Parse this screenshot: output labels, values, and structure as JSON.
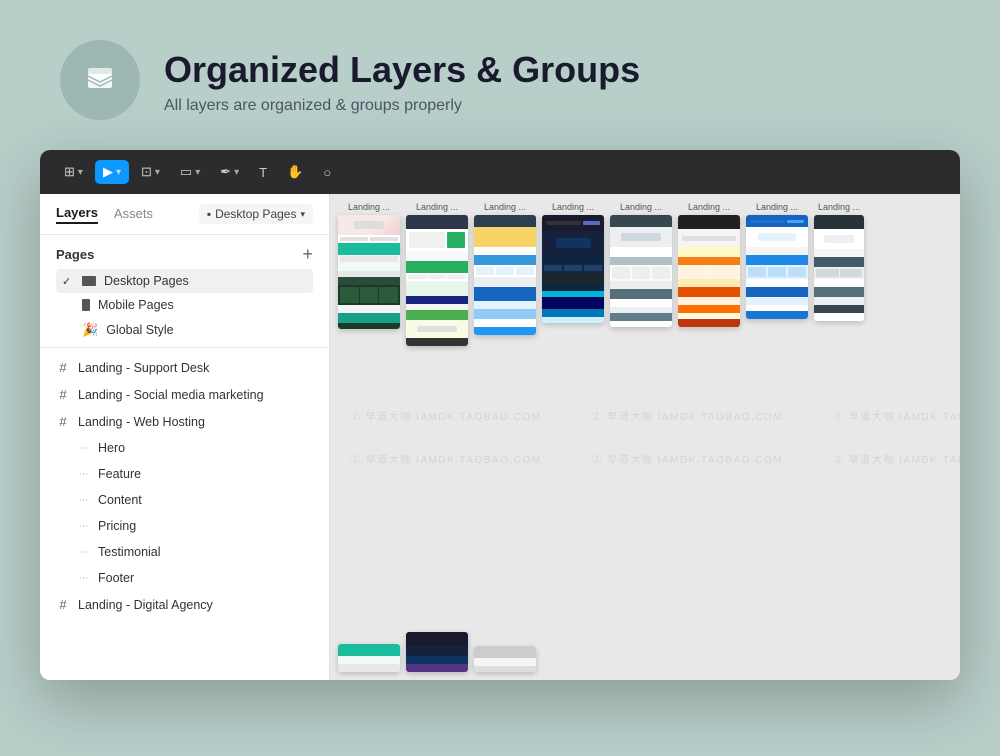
{
  "header": {
    "title": "Organized Layers & Groups",
    "subtitle": "All layers are organized & groups properly",
    "logo_alt": "layers-logo"
  },
  "toolbar": {
    "tools": [
      {
        "id": "frame-tool",
        "label": "⊞",
        "active": false
      },
      {
        "id": "move-tool",
        "label": "▶",
        "active": true
      },
      {
        "id": "scale-tool",
        "label": "⊡",
        "active": false
      },
      {
        "id": "shape-tool",
        "label": "▭",
        "active": false
      },
      {
        "id": "pen-tool",
        "label": "✒",
        "active": false
      },
      {
        "id": "text-tool",
        "label": "T",
        "active": false
      },
      {
        "id": "hand-tool",
        "label": "✋",
        "active": false
      },
      {
        "id": "comment-tool",
        "label": "💬",
        "active": false
      }
    ]
  },
  "left_panel": {
    "tabs": [
      {
        "id": "layers-tab",
        "label": "Layers",
        "active": true
      },
      {
        "id": "assets-tab",
        "label": "Assets",
        "active": false
      }
    ],
    "page_selector": {
      "label": "Desktop Pages",
      "icon": "monitor"
    },
    "pages_section": {
      "title": "Pages",
      "add_label": "+",
      "items": [
        {
          "id": "desktop-pages",
          "label": "Desktop Pages",
          "active": true,
          "checked": true,
          "type": "desktop"
        },
        {
          "id": "mobile-pages",
          "label": "Mobile Pages",
          "active": false,
          "checked": false,
          "type": "mobile"
        },
        {
          "id": "global-style",
          "label": "Global Style",
          "active": false,
          "checked": false,
          "type": "emoji",
          "emoji": "🎉"
        }
      ]
    },
    "layers": [
      {
        "id": "support-desk",
        "label": "Landing - Support Desk",
        "indent": 0,
        "icon": "hash"
      },
      {
        "id": "social-media",
        "label": "Landing - Social media marketing",
        "indent": 0,
        "icon": "hash"
      },
      {
        "id": "web-hosting",
        "label": "Landing - Web Hosting",
        "indent": 0,
        "icon": "hash"
      },
      {
        "id": "hero",
        "label": "Hero",
        "indent": 1,
        "icon": "dots"
      },
      {
        "id": "feature",
        "label": "Feature",
        "indent": 1,
        "icon": "dots"
      },
      {
        "id": "content",
        "label": "Content",
        "indent": 1,
        "icon": "dots"
      },
      {
        "id": "pricing",
        "label": "Pricing",
        "indent": 1,
        "icon": "dots"
      },
      {
        "id": "testimonial",
        "label": "Testimonial",
        "indent": 1,
        "icon": "dots"
      },
      {
        "id": "footer",
        "label": "Footer",
        "indent": 1,
        "icon": "dots"
      },
      {
        "id": "digital-agency",
        "label": "Landing - Digital Agency",
        "indent": 0,
        "icon": "hash"
      }
    ]
  },
  "canvas": {
    "bg_color": "#e8e8e8",
    "watermarks": [
      "Z 早道大咖  IAMDK.TAOBAO.COM",
      "Z 早道大咖  IAMDK.TAOBAO.COM",
      "Z 早道大咖  IAMDK.TAOBAO.COM"
    ],
    "thumbnails": [
      {
        "label": "Landing ...",
        "color_scheme": "teal_dark"
      },
      {
        "label": "Landing ...",
        "color_scheme": "green_white"
      },
      {
        "label": "Landing ...",
        "color_scheme": "blue_light"
      },
      {
        "label": "Landing ...",
        "color_scheme": "dark_blue"
      },
      {
        "label": "Landing ...",
        "color_scheme": "white_gray"
      },
      {
        "label": "Landing ...",
        "color_scheme": "dark_yellow"
      },
      {
        "label": "Landing ...",
        "color_scheme": "white_blue"
      },
      {
        "label": "Landing ...",
        "color_scheme": "navy_white"
      }
    ]
  }
}
